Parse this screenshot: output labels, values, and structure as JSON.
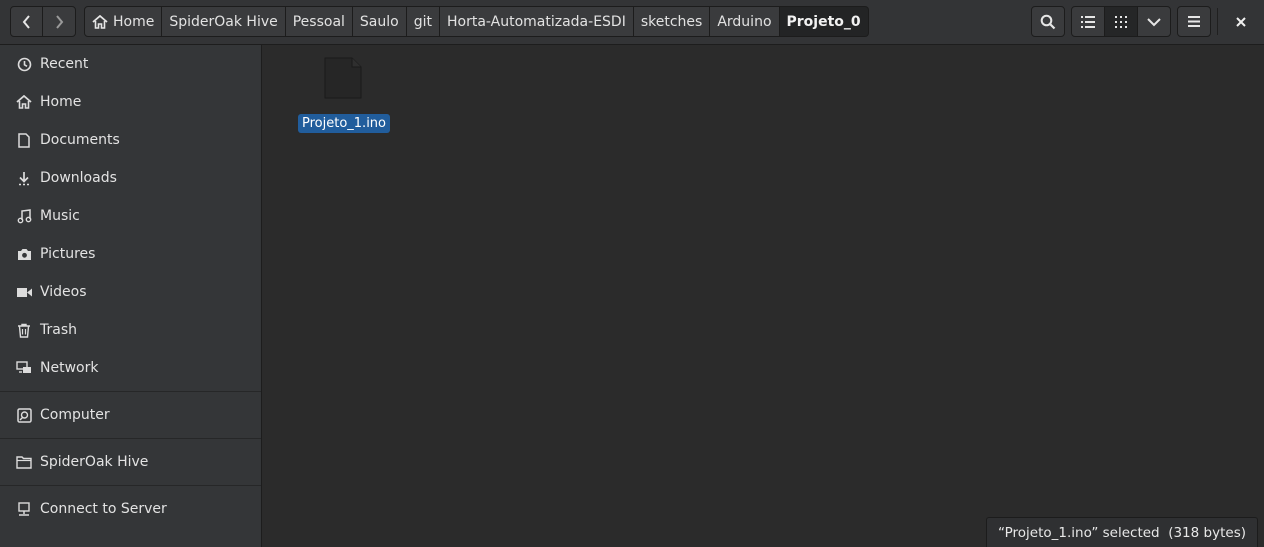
{
  "breadcrumbs": [
    {
      "label": "Home",
      "icon": "home-icon"
    },
    {
      "label": "SpiderOak Hive"
    },
    {
      "label": "Pessoal"
    },
    {
      "label": "Saulo"
    },
    {
      "label": "git"
    },
    {
      "label": "Horta-Automatizada-ESDI"
    },
    {
      "label": "sketches"
    },
    {
      "label": "Arduino"
    },
    {
      "label": "Projeto_0",
      "current": true
    }
  ],
  "toolbar": {
    "search_icon": "search-icon",
    "list_view_icon": "list-view-icon",
    "grid_view_icon": "grid-view-icon",
    "view_options_icon": "chevron-down-icon",
    "menu_icon": "hamburger-menu-icon",
    "close_icon": "close-icon"
  },
  "sidebar": {
    "items": [
      {
        "label": "Recent",
        "icon": "clock-icon"
      },
      {
        "label": "Home",
        "icon": "home-icon"
      },
      {
        "label": "Documents",
        "icon": "document-icon"
      },
      {
        "label": "Downloads",
        "icon": "download-icon"
      },
      {
        "label": "Music",
        "icon": "music-icon"
      },
      {
        "label": "Pictures",
        "icon": "camera-icon"
      },
      {
        "label": "Videos",
        "icon": "video-icon"
      },
      {
        "label": "Trash",
        "icon": "trash-icon"
      },
      {
        "label": "Network",
        "icon": "network-icon"
      }
    ],
    "devices": [
      {
        "label": "Computer",
        "icon": "harddisk-icon"
      }
    ],
    "bookmarks": [
      {
        "label": "SpiderOak Hive",
        "icon": "folder-icon"
      }
    ],
    "other": [
      {
        "label": "Connect to Server",
        "icon": "server-icon"
      }
    ]
  },
  "files": [
    {
      "name": "Projeto_1.ino",
      "selected": true
    }
  ],
  "status": {
    "text": "“Projeto_1.ino” selected  (318 bytes)"
  },
  "colors": {
    "selection": "#215d9c",
    "background": "#2b2b2b",
    "sidebar": "#343638"
  }
}
